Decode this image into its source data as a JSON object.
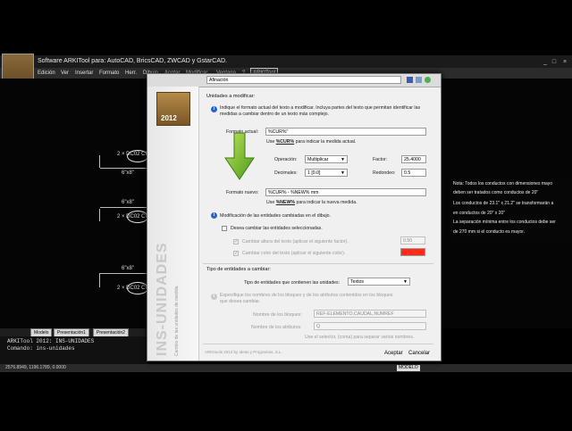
{
  "window": {
    "title": "Software ARKITool para: AutoCAD, BricsCAD, ZWCAD y GstarCAD.",
    "logo_year": "2012",
    "menu": [
      "Edición",
      "Ver",
      "Insertar",
      "Formato",
      "Herr.",
      "Dibujo",
      "Acotar",
      "Modificar",
      "Ventana",
      "?",
      "ARKITool"
    ]
  },
  "drawing": {
    "labels": [
      "2 × DC02 CIE 18",
      "2 × DC02 CIE 18",
      "2 × DC02 CIE 18"
    ],
    "dims": [
      "6\"x8\"",
      "6\"x8\"",
      "6\"x8\""
    ],
    "note": {
      "lines": [
        "Nota: Todos los conductos con dimensiones mayo",
        "deben ser tratados como conductos de 20\"",
        "Los conductos de 23.1\" x 21.2\" se transformarán a",
        "en conductos de 20\" x 20\"",
        "La separación mínima entre los conductos debe ser",
        "de 270 mm si el conducto es mayor."
      ]
    }
  },
  "layout_tabs": [
    "Modelo",
    "Presentación1",
    "Presentación2"
  ],
  "command_lines": [
    "ARKITool 2012: INS-UNIDADES",
    "Comando: ins-unidades"
  ],
  "status": {
    "coords": "2576.8949, 1196.1789, 0.0000",
    "mode": "MODELO"
  },
  "dialog": {
    "logo_year": "2012",
    "vertical_title": "INS-UNIDADES",
    "vertical_subtitle": "Cambio de las unidades de medida.",
    "top_dropdown": "Afinación",
    "section1": "Unidades a modificar:",
    "info1": "Indique el formato actual del texto a modificar. Incluya partes del texto que permitan identificar las medidas a cambiar dentro de un texto más complejo.",
    "formato_actual_label": "Formato actual:",
    "formato_actual_value": "%CUR%\"",
    "formato_actual_hint_pre": "Use",
    "formato_actual_hint_token": "%CUR%",
    "formato_actual_hint_post": "para indicar la medida actual.",
    "operacion_label": "Operación:",
    "operacion_value": "Multiplicar",
    "factor_label": "Factor:",
    "factor_value": "25.4000",
    "decimales_label": "Decimales:",
    "decimales_value": "1 [0.0]",
    "redondeo_label": "Redondeo:",
    "redondeo_value": "0.5",
    "formato_nuevo_label": "Formato nuevo:",
    "formato_nuevo_value": "%CUR% - %NEW% mm",
    "formato_nuevo_hint_pre": "Use",
    "formato_nuevo_hint_token": "%NEW%",
    "formato_nuevo_hint_post": "para indicar la nueva medida.",
    "info2": "Modificación de las entidades cambiadas en el dibujo.",
    "cb_cambiar": "Desea cambiar las entidades seleccionadas.",
    "cb_altura": "Cambiar altura del texto (aplicar el siguiente factor).",
    "altura_value": "0.50",
    "cb_color": "Cambiar color del texto (aplicar el siguiente color).",
    "color_value": "#ff2a1a",
    "section2": "Tipo de entidades a cambiar:",
    "tipo_label": "Tipo de entidades que contienen las unidades:",
    "tipo_value": "Textos",
    "info3": "Especifique los nombres de los bloques y de los atributos contenidos en los bloques que desea cambiar.",
    "bloques_label": "Nombre de los bloques:",
    "bloques_value": "REF-ELEMENTO,CAUDAL,NUMREF",
    "atributos_label": "Nombre de los atributos:",
    "atributos_value": "Q",
    "selector_hint": "Use el selector, (coma) para separar varios nombres.",
    "copyright": "ARKItools 2012 by Ideas y Programas, S.L.",
    "accept": "Aceptar",
    "cancel": "Cancelar"
  }
}
